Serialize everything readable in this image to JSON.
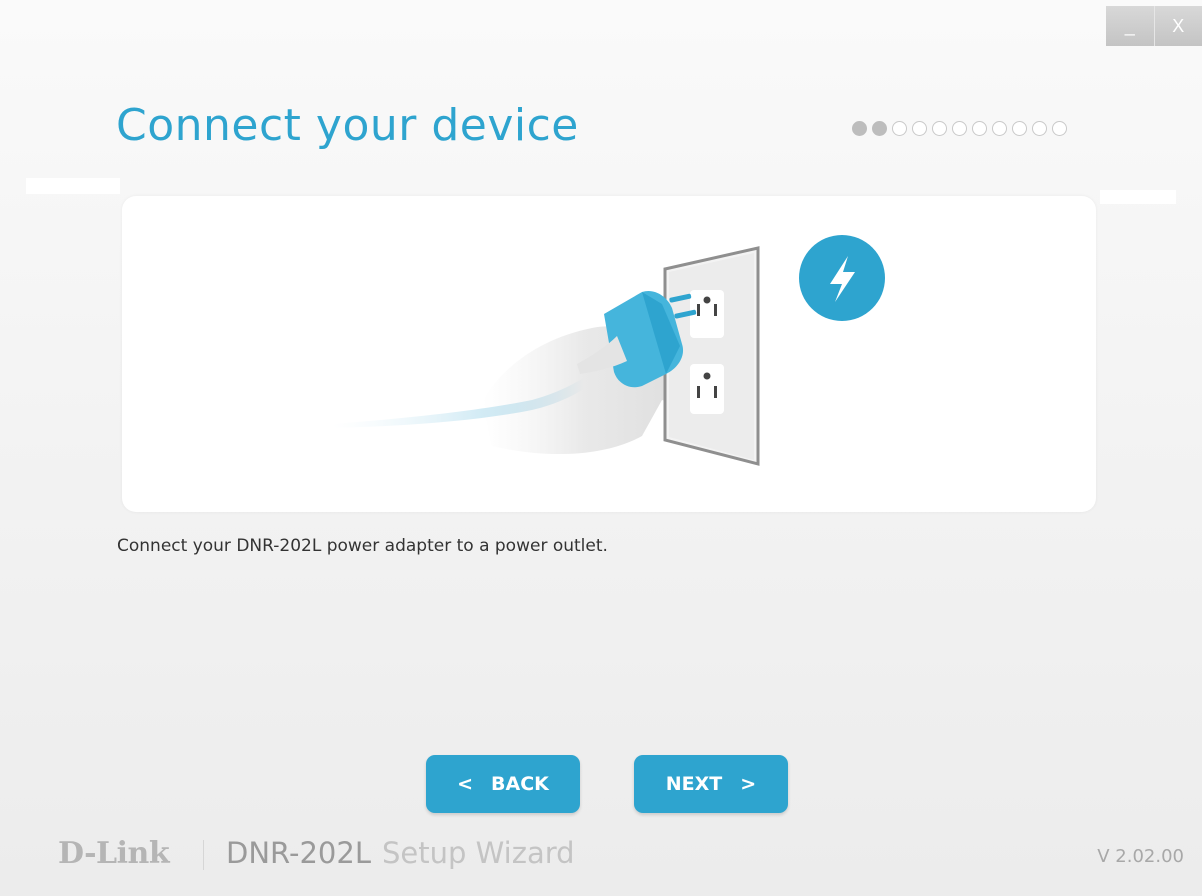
{
  "window": {
    "minimize_label": "_",
    "close_label": "X"
  },
  "header": {
    "title": "Connect your device",
    "steps_total": 11,
    "steps_completed": 2
  },
  "illustration": {
    "icons": [
      "lightning-bolt-icon",
      "power-outlet",
      "power-plug",
      "hand"
    ],
    "accent_color": "#2ea4cf"
  },
  "content": {
    "description": "Connect your DNR-202L power adapter to a power outlet."
  },
  "navigation": {
    "back_arrow": "<",
    "back_label": "BACK",
    "next_label": "NEXT",
    "next_arrow": ">"
  },
  "footer": {
    "brand": "D-Link",
    "product": "DNR-202L",
    "wizard": "Setup Wizard",
    "version": "V 2.02.00"
  }
}
